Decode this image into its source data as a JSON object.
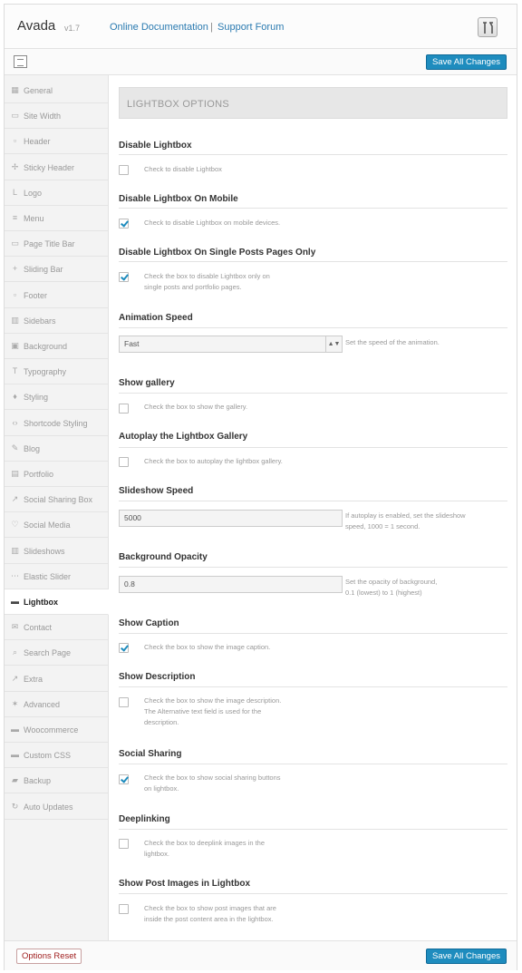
{
  "header": {
    "brand": "Avada",
    "version": "v1.7",
    "doc_link": "Online Documentation",
    "separator": "|",
    "forum_link": "Support Forum",
    "icon": "tools-icon"
  },
  "toolbar": {
    "save_label": "Save All Changes",
    "icon": "collapse-icon"
  },
  "sidebar": {
    "items": [
      {
        "label": "General",
        "icon": "grid-icon",
        "glyph": "▦"
      },
      {
        "label": "Site Width",
        "icon": "width-icon",
        "glyph": "▭"
      },
      {
        "label": "Header",
        "icon": "header-icon",
        "glyph": "▫"
      },
      {
        "label": "Sticky Header",
        "icon": "sticky-icon",
        "glyph": "✢"
      },
      {
        "label": "Logo",
        "icon": "logo-icon",
        "glyph": "L"
      },
      {
        "label": "Menu",
        "icon": "menu-icon",
        "glyph": "≡"
      },
      {
        "label": "Page Title Bar",
        "icon": "title-bar-icon",
        "glyph": "▭"
      },
      {
        "label": "Sliding Bar",
        "icon": "plus-icon",
        "glyph": "+"
      },
      {
        "label": "Footer",
        "icon": "footer-icon",
        "glyph": "▫"
      },
      {
        "label": "Sidebars",
        "icon": "sidebars-icon",
        "glyph": "▥"
      },
      {
        "label": "Background",
        "icon": "background-icon",
        "glyph": "▣"
      },
      {
        "label": "Typography",
        "icon": "typography-icon",
        "glyph": "T"
      },
      {
        "label": "Styling",
        "icon": "drop-icon",
        "glyph": "♦"
      },
      {
        "label": "Shortcode Styling",
        "icon": "code-icon",
        "glyph": "‹›"
      },
      {
        "label": "Blog",
        "icon": "pen-icon",
        "glyph": "✎"
      },
      {
        "label": "Portfolio",
        "icon": "portfolio-icon",
        "glyph": "▤"
      },
      {
        "label": "Social Sharing Box",
        "icon": "share-icon",
        "glyph": "↗"
      },
      {
        "label": "Social Media",
        "icon": "heart-icon",
        "glyph": "♡"
      },
      {
        "label": "Slideshows",
        "icon": "slideshow-icon",
        "glyph": "▥"
      },
      {
        "label": "Elastic Slider",
        "icon": "slider-icon",
        "glyph": "⋯"
      },
      {
        "label": "Lightbox",
        "icon": "lightbox-icon",
        "glyph": "▬",
        "active": true
      },
      {
        "label": "Contact",
        "icon": "envelope-icon",
        "glyph": "✉"
      },
      {
        "label": "Search Page",
        "icon": "search-icon",
        "glyph": "⌕"
      },
      {
        "label": "Extra",
        "icon": "external-icon",
        "glyph": "↗"
      },
      {
        "label": "Advanced",
        "icon": "star-icon",
        "glyph": "✶"
      },
      {
        "label": "Woocommerce",
        "icon": "cart-icon",
        "glyph": "▬"
      },
      {
        "label": "Custom CSS",
        "icon": "css-icon",
        "glyph": "▬"
      },
      {
        "label": "Backup",
        "icon": "backup-icon",
        "glyph": "▰"
      },
      {
        "label": "Auto Updates",
        "icon": "refresh-icon",
        "glyph": "↻"
      }
    ]
  },
  "main": {
    "section_title": "LIGHTBOX OPTIONS",
    "options": {
      "disable_lightbox": {
        "title": "Disable Lightbox",
        "checked": false,
        "desc": "Check to disable Lightbox"
      },
      "disable_mobile": {
        "title": "Disable Lightbox On Mobile",
        "checked": true,
        "desc": "Check to disable Lightbox on mobile devices."
      },
      "disable_single": {
        "title": "Disable Lightbox On Single Posts Pages Only",
        "checked": true,
        "desc1": "Check the box to disable Lightbox only on",
        "desc2": "single posts and portfolio pages."
      },
      "animation_speed": {
        "title": "Animation Speed",
        "value": "Fast",
        "desc": "Set the speed of the animation."
      },
      "show_gallery": {
        "title": "Show gallery",
        "checked": false,
        "desc": "Check the box to show the gallery."
      },
      "autoplay": {
        "title": "Autoplay the Lightbox Gallery",
        "checked": false,
        "desc": "Check the box to autoplay the lightbox gallery."
      },
      "slideshow_speed": {
        "title": "Slideshow Speed",
        "value": "5000",
        "desc1": "If autoplay is enabled, set the slideshow",
        "desc2": "speed, 1000 = 1 second."
      },
      "bg_opacity": {
        "title": "Background Opacity",
        "value": "0.8",
        "desc1": "Set the opacity of background,",
        "desc2": "0.1 (lowest) to 1 (highest)"
      },
      "show_caption": {
        "title": "Show Caption",
        "checked": true,
        "desc": "Check the box to show the image caption."
      },
      "show_description": {
        "title": "Show Description",
        "checked": false,
        "desc1": "Check the box to show the image description.",
        "desc2": "The Alternative text field is used for the",
        "desc3": "description."
      },
      "social_sharing": {
        "title": "Social Sharing",
        "checked": true,
        "desc1": "Check the box to show social sharing buttons",
        "desc2": "on lightbox."
      },
      "deeplinking": {
        "title": "Deeplinking",
        "checked": false,
        "desc1": "Check the box to deeplink images in the",
        "desc2": "lightbox."
      },
      "post_images": {
        "title": "Show Post Images in Lightbox",
        "checked": false,
        "desc1": "Check the box to show post images that are",
        "desc2": "inside the post content area in the lightbox."
      }
    }
  },
  "footer": {
    "reset_label": "Options Reset",
    "save_label": "Save All Changes"
  },
  "colors": {
    "accent": "#1e8cbe",
    "reset": "#a02020"
  }
}
